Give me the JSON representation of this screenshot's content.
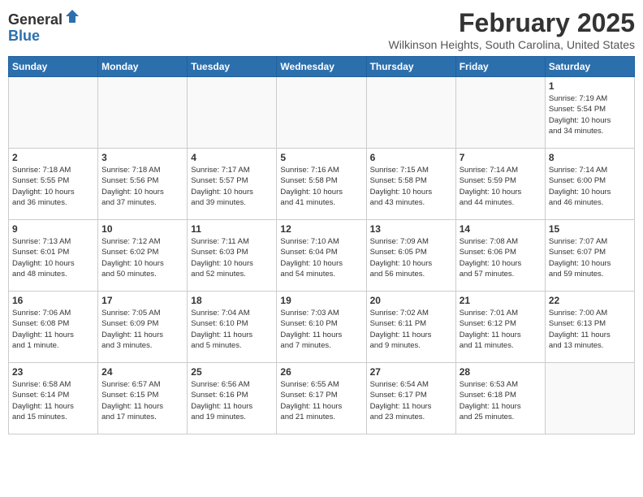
{
  "logo": {
    "general": "General",
    "blue": "Blue"
  },
  "header": {
    "month": "February 2025",
    "location": "Wilkinson Heights, South Carolina, United States"
  },
  "weekdays": [
    "Sunday",
    "Monday",
    "Tuesday",
    "Wednesday",
    "Thursday",
    "Friday",
    "Saturday"
  ],
  "weeks": [
    [
      {
        "day": "",
        "info": ""
      },
      {
        "day": "",
        "info": ""
      },
      {
        "day": "",
        "info": ""
      },
      {
        "day": "",
        "info": ""
      },
      {
        "day": "",
        "info": ""
      },
      {
        "day": "",
        "info": ""
      },
      {
        "day": "1",
        "info": "Sunrise: 7:19 AM\nSunset: 5:54 PM\nDaylight: 10 hours\nand 34 minutes."
      }
    ],
    [
      {
        "day": "2",
        "info": "Sunrise: 7:18 AM\nSunset: 5:55 PM\nDaylight: 10 hours\nand 36 minutes."
      },
      {
        "day": "3",
        "info": "Sunrise: 7:18 AM\nSunset: 5:56 PM\nDaylight: 10 hours\nand 37 minutes."
      },
      {
        "day": "4",
        "info": "Sunrise: 7:17 AM\nSunset: 5:57 PM\nDaylight: 10 hours\nand 39 minutes."
      },
      {
        "day": "5",
        "info": "Sunrise: 7:16 AM\nSunset: 5:58 PM\nDaylight: 10 hours\nand 41 minutes."
      },
      {
        "day": "6",
        "info": "Sunrise: 7:15 AM\nSunset: 5:58 PM\nDaylight: 10 hours\nand 43 minutes."
      },
      {
        "day": "7",
        "info": "Sunrise: 7:14 AM\nSunset: 5:59 PM\nDaylight: 10 hours\nand 44 minutes."
      },
      {
        "day": "8",
        "info": "Sunrise: 7:14 AM\nSunset: 6:00 PM\nDaylight: 10 hours\nand 46 minutes."
      }
    ],
    [
      {
        "day": "9",
        "info": "Sunrise: 7:13 AM\nSunset: 6:01 PM\nDaylight: 10 hours\nand 48 minutes."
      },
      {
        "day": "10",
        "info": "Sunrise: 7:12 AM\nSunset: 6:02 PM\nDaylight: 10 hours\nand 50 minutes."
      },
      {
        "day": "11",
        "info": "Sunrise: 7:11 AM\nSunset: 6:03 PM\nDaylight: 10 hours\nand 52 minutes."
      },
      {
        "day": "12",
        "info": "Sunrise: 7:10 AM\nSunset: 6:04 PM\nDaylight: 10 hours\nand 54 minutes."
      },
      {
        "day": "13",
        "info": "Sunrise: 7:09 AM\nSunset: 6:05 PM\nDaylight: 10 hours\nand 56 minutes."
      },
      {
        "day": "14",
        "info": "Sunrise: 7:08 AM\nSunset: 6:06 PM\nDaylight: 10 hours\nand 57 minutes."
      },
      {
        "day": "15",
        "info": "Sunrise: 7:07 AM\nSunset: 6:07 PM\nDaylight: 10 hours\nand 59 minutes."
      }
    ],
    [
      {
        "day": "16",
        "info": "Sunrise: 7:06 AM\nSunset: 6:08 PM\nDaylight: 11 hours\nand 1 minute."
      },
      {
        "day": "17",
        "info": "Sunrise: 7:05 AM\nSunset: 6:09 PM\nDaylight: 11 hours\nand 3 minutes."
      },
      {
        "day": "18",
        "info": "Sunrise: 7:04 AM\nSunset: 6:10 PM\nDaylight: 11 hours\nand 5 minutes."
      },
      {
        "day": "19",
        "info": "Sunrise: 7:03 AM\nSunset: 6:10 PM\nDaylight: 11 hours\nand 7 minutes."
      },
      {
        "day": "20",
        "info": "Sunrise: 7:02 AM\nSunset: 6:11 PM\nDaylight: 11 hours\nand 9 minutes."
      },
      {
        "day": "21",
        "info": "Sunrise: 7:01 AM\nSunset: 6:12 PM\nDaylight: 11 hours\nand 11 minutes."
      },
      {
        "day": "22",
        "info": "Sunrise: 7:00 AM\nSunset: 6:13 PM\nDaylight: 11 hours\nand 13 minutes."
      }
    ],
    [
      {
        "day": "23",
        "info": "Sunrise: 6:58 AM\nSunset: 6:14 PM\nDaylight: 11 hours\nand 15 minutes."
      },
      {
        "day": "24",
        "info": "Sunrise: 6:57 AM\nSunset: 6:15 PM\nDaylight: 11 hours\nand 17 minutes."
      },
      {
        "day": "25",
        "info": "Sunrise: 6:56 AM\nSunset: 6:16 PM\nDaylight: 11 hours\nand 19 minutes."
      },
      {
        "day": "26",
        "info": "Sunrise: 6:55 AM\nSunset: 6:17 PM\nDaylight: 11 hours\nand 21 minutes."
      },
      {
        "day": "27",
        "info": "Sunrise: 6:54 AM\nSunset: 6:17 PM\nDaylight: 11 hours\nand 23 minutes."
      },
      {
        "day": "28",
        "info": "Sunrise: 6:53 AM\nSunset: 6:18 PM\nDaylight: 11 hours\nand 25 minutes."
      },
      {
        "day": "",
        "info": ""
      }
    ]
  ]
}
